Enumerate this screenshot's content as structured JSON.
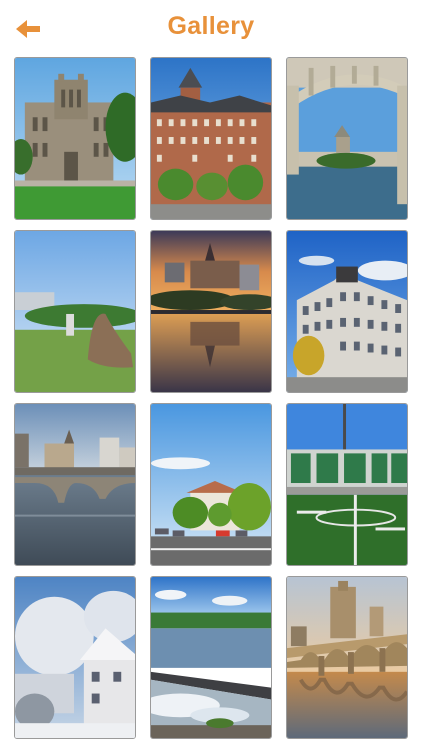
{
  "header": {
    "title": "Gallery",
    "back_icon": "arrow-left-icon",
    "accent_color": "#e8913a"
  },
  "gallery": {
    "photos": [
      {
        "name": "photo-university-building"
      },
      {
        "name": "photo-chateau-hotel"
      },
      {
        "name": "photo-bridge-arch"
      },
      {
        "name": "photo-sculpture-park"
      },
      {
        "name": "photo-sunset-reflection"
      },
      {
        "name": "photo-glass-building"
      },
      {
        "name": "photo-river-bridge"
      },
      {
        "name": "photo-street-trees"
      },
      {
        "name": "photo-stadium-field"
      },
      {
        "name": "photo-winter-houses"
      },
      {
        "name": "photo-river-weir"
      },
      {
        "name": "photo-bridge-sunset"
      }
    ]
  }
}
